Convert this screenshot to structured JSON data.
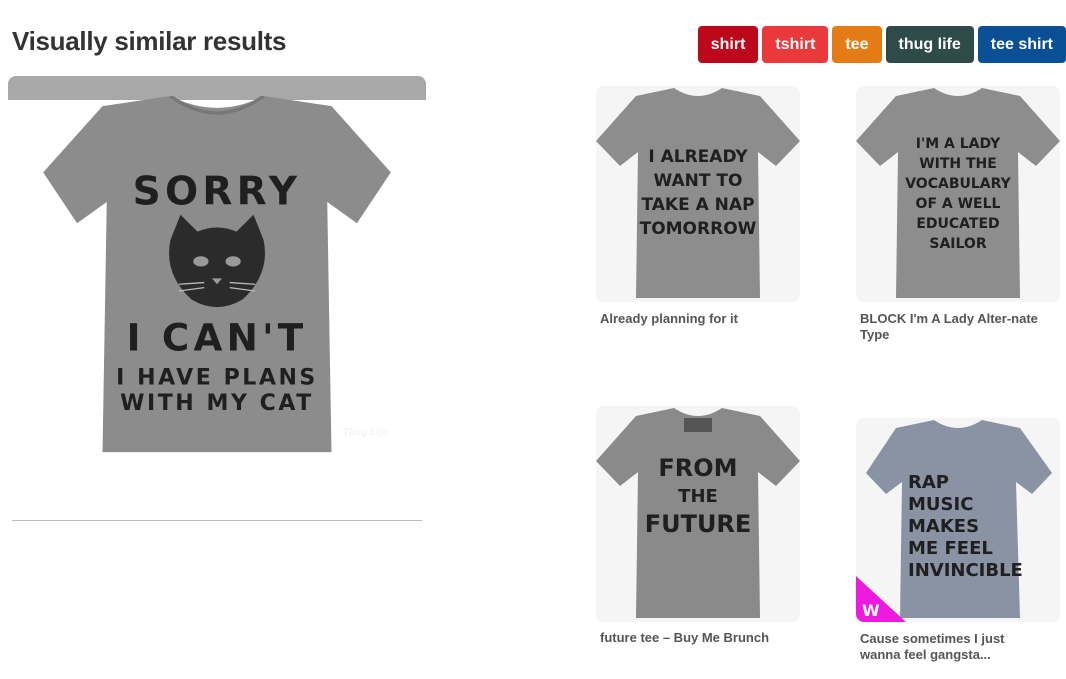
{
  "page": {
    "title": "Visually similar results"
  },
  "tags": [
    {
      "label": "shirt",
      "color": "#bd081c"
    },
    {
      "label": "tshirt",
      "color": "#e9393b"
    },
    {
      "label": "tee",
      "color": "#e37c14"
    },
    {
      "label": "thug life",
      "color": "#2f4b49"
    },
    {
      "label": "tee shirt",
      "color": "#0b4f94"
    }
  ],
  "main_pin": {
    "shirt_lines": [
      "SORRY",
      "I CAN'T",
      "I HAVE PLANS",
      "WITH MY CAT"
    ],
    "brand_mark": "Thug Life"
  },
  "results": [
    {
      "caption": "Already planning for it",
      "shirt_lines": [
        "I ALREADY",
        "WANT TO",
        "TAKE A NAP",
        "TOMORROW"
      ]
    },
    {
      "caption": "BLOCK I'm A Lady Alter-nate Type",
      "shirt_lines": [
        "I'M A LADY",
        "WITH THE",
        "VOCABULARY",
        "OF A WELL",
        "EDUCATED",
        "SAILOR"
      ]
    },
    {
      "caption": "future tee – Buy Me Brunch",
      "shirt_lines": [
        "FROM",
        "THE",
        "FUTURE"
      ]
    },
    {
      "caption": "Cause sometimes I just wanna feel gangsta...",
      "shirt_lines": [
        "RAP",
        "MUSIC",
        "MAKES",
        "ME FEEL",
        "INVINCIBLE"
      ],
      "badge": "W"
    }
  ]
}
